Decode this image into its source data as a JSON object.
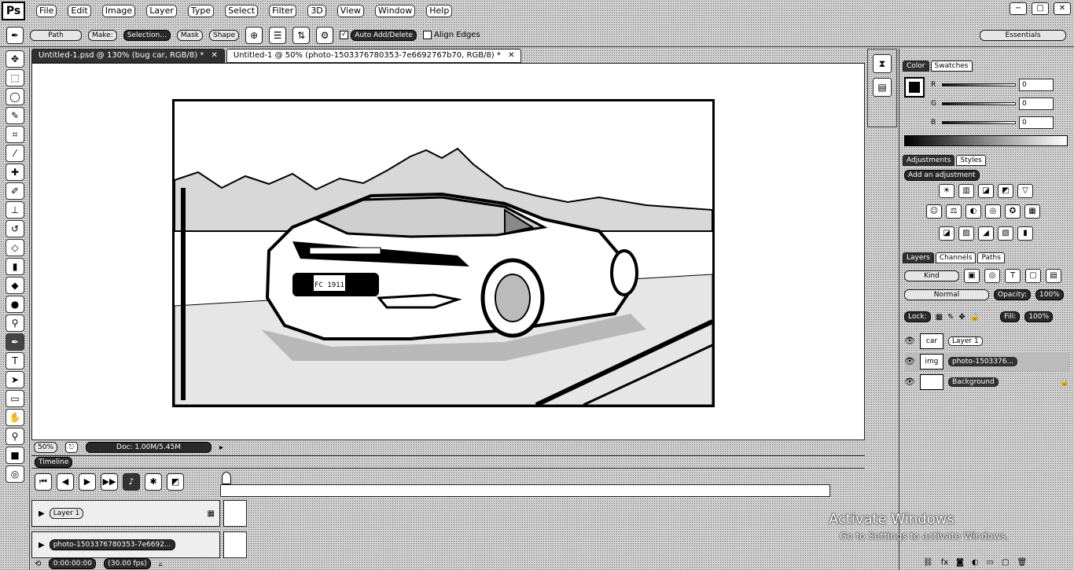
{
  "app": {
    "logo": "Ps"
  },
  "menu": [
    "File",
    "Edit",
    "Image",
    "Layer",
    "Type",
    "Select",
    "Filter",
    "3D",
    "View",
    "Window",
    "Help"
  ],
  "window_controls": [
    "−",
    "□",
    "✕"
  ],
  "options": {
    "tool_mode": "Path",
    "make_label": "Make:",
    "selection": "Selection...",
    "mask": "Mask",
    "shape": "Shape",
    "auto_add_delete": "Auto Add/Delete",
    "auto_add_checked": true,
    "align_edges": "Align Edges",
    "align_checked": false,
    "workspace": "Essentials"
  },
  "tools": [
    "move",
    "marquee",
    "lasso",
    "quick-select",
    "crop",
    "eyedropper",
    "healing",
    "brush",
    "clone-stamp",
    "history-brush",
    "eraser",
    "gradient",
    "blur",
    "dodge",
    "pen",
    "type",
    "path-select",
    "rectangle",
    "hand",
    "zoom"
  ],
  "tabs": [
    {
      "label": "Untitled-1.psd @ 130% (bug car, RGB/8) *",
      "active": true
    },
    {
      "label": "Untitled-1 @ 50% (photo-1503376780353-7e6692767b70, RGB/8) *",
      "active": false
    }
  ],
  "status": {
    "zoom": "50%",
    "doc": "Doc: 1.00M/5.45M"
  },
  "plate": "FC 1911",
  "timeline": {
    "title": "Timeline",
    "tracks": [
      {
        "name": "Layer 1"
      },
      {
        "name": "photo-1503376780353-7e6692..."
      }
    ],
    "timecode": "0:00:00:00",
    "fps": "(30.00 fps)"
  },
  "color_panel": {
    "tabs": [
      "Color",
      "Swatches"
    ],
    "channels": [
      {
        "label": "R",
        "value": "0"
      },
      {
        "label": "G",
        "value": "0"
      },
      {
        "label": "B",
        "value": "0"
      }
    ]
  },
  "adjust_panel": {
    "tabs": [
      "Adjustments",
      "Styles"
    ],
    "add_label": "Add an adjustment"
  },
  "layers_panel": {
    "tabs": [
      "Layers",
      "Channels",
      "Paths"
    ],
    "kind": "Kind",
    "blend": "Normal",
    "opacity_label": "Opacity:",
    "opacity": "100%",
    "lock_label": "Lock:",
    "fill_label": "Fill:",
    "fill": "100%",
    "layers": [
      {
        "name": "Layer 1",
        "thumb": "car",
        "selected": false
      },
      {
        "name": "photo-1503376...",
        "thumb": "img",
        "selected": true
      },
      {
        "name": "Background",
        "thumb": "",
        "selected": false
      }
    ]
  },
  "watermark": {
    "title": "Activate Windows",
    "subtitle": "Go to Settings to activate Windows."
  }
}
